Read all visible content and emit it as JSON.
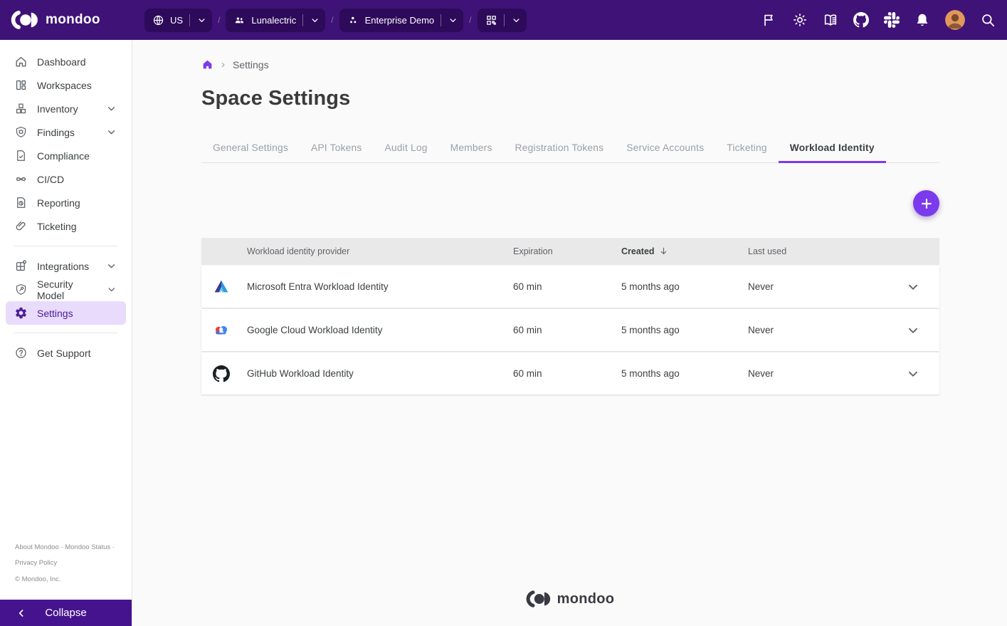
{
  "colors": {
    "topbar_bg": "#3F1277",
    "pill_bg": "#2D0A5A",
    "accent": "#7C3AED",
    "active_nav_bg": "#E9DBFB",
    "active_nav_text": "#4A1D96",
    "collapse_bg": "#46138E",
    "main_bg": "#FAFAFA",
    "table_header_bg": "#E9E9E9",
    "tab_inactive": "#9AA0A6",
    "text_primary": "#3C4043",
    "text_muted": "#5F6368"
  },
  "topbar": {
    "brand": "mondoo",
    "separator": "/",
    "region": {
      "label": "US",
      "icon": "globe-icon"
    },
    "org": {
      "label": "Lunalectric",
      "icon": "organization-icon"
    },
    "space": {
      "label": "Enterprise Demo",
      "icon": "space-icon"
    },
    "workspace_picker": {
      "icon": "workspace-grid-icon"
    },
    "action_icons": [
      "flag-icon",
      "theme-toggle-icon",
      "docs-icon",
      "github-icon",
      "slack-icon",
      "notifications-icon",
      "user-avatar",
      "search-icon"
    ]
  },
  "sidebar": {
    "items": [
      {
        "label": "Dashboard"
      },
      {
        "label": "Workspaces"
      },
      {
        "label": "Inventory",
        "expandable": true
      },
      {
        "label": "Findings",
        "expandable": true
      },
      {
        "label": "Compliance"
      },
      {
        "label": "CI/CD"
      },
      {
        "label": "Reporting"
      },
      {
        "label": "Ticketing"
      },
      {
        "label": "Integrations",
        "expandable": true
      },
      {
        "label": "Security Model",
        "expandable": true
      },
      {
        "label": "Settings",
        "active": true
      },
      {
        "label": "Get Support"
      }
    ],
    "footer": {
      "line1": "About Mondoo · Mondoo Status ·",
      "line2": "Privacy Policy",
      "line3": "© Mondoo, Inc."
    },
    "collapse_label": "Collapse"
  },
  "main": {
    "breadcrumb": {
      "separator": "›",
      "current": "Settings"
    },
    "title": "Space Settings",
    "tabs": [
      {
        "label": "General Settings"
      },
      {
        "label": "API Tokens"
      },
      {
        "label": "Audit Log"
      },
      {
        "label": "Members"
      },
      {
        "label": "Registration Tokens"
      },
      {
        "label": "Service Accounts"
      },
      {
        "label": "Ticketing"
      },
      {
        "label": "Workload Identity",
        "active": true
      }
    ],
    "table": {
      "columns": [
        "Workload identity provider",
        "Expiration",
        "Created",
        "Last used"
      ],
      "sort": {
        "column": "Created",
        "direction": "desc"
      },
      "rows": [
        {
          "icon": "microsoft-entra-icon",
          "provider": "Microsoft Entra Workload Identity",
          "expiration": "60 min",
          "created": "5 months ago",
          "last_used": "Never"
        },
        {
          "icon": "google-cloud-icon",
          "provider": "Google Cloud Workload Identity",
          "expiration": "60 min",
          "created": "5 months ago",
          "last_used": "Never"
        },
        {
          "icon": "github-icon",
          "provider": "GitHub Workload Identity",
          "expiration": "60 min",
          "created": "5 months ago",
          "last_used": "Never"
        }
      ]
    },
    "footer_brand": "mondoo"
  }
}
